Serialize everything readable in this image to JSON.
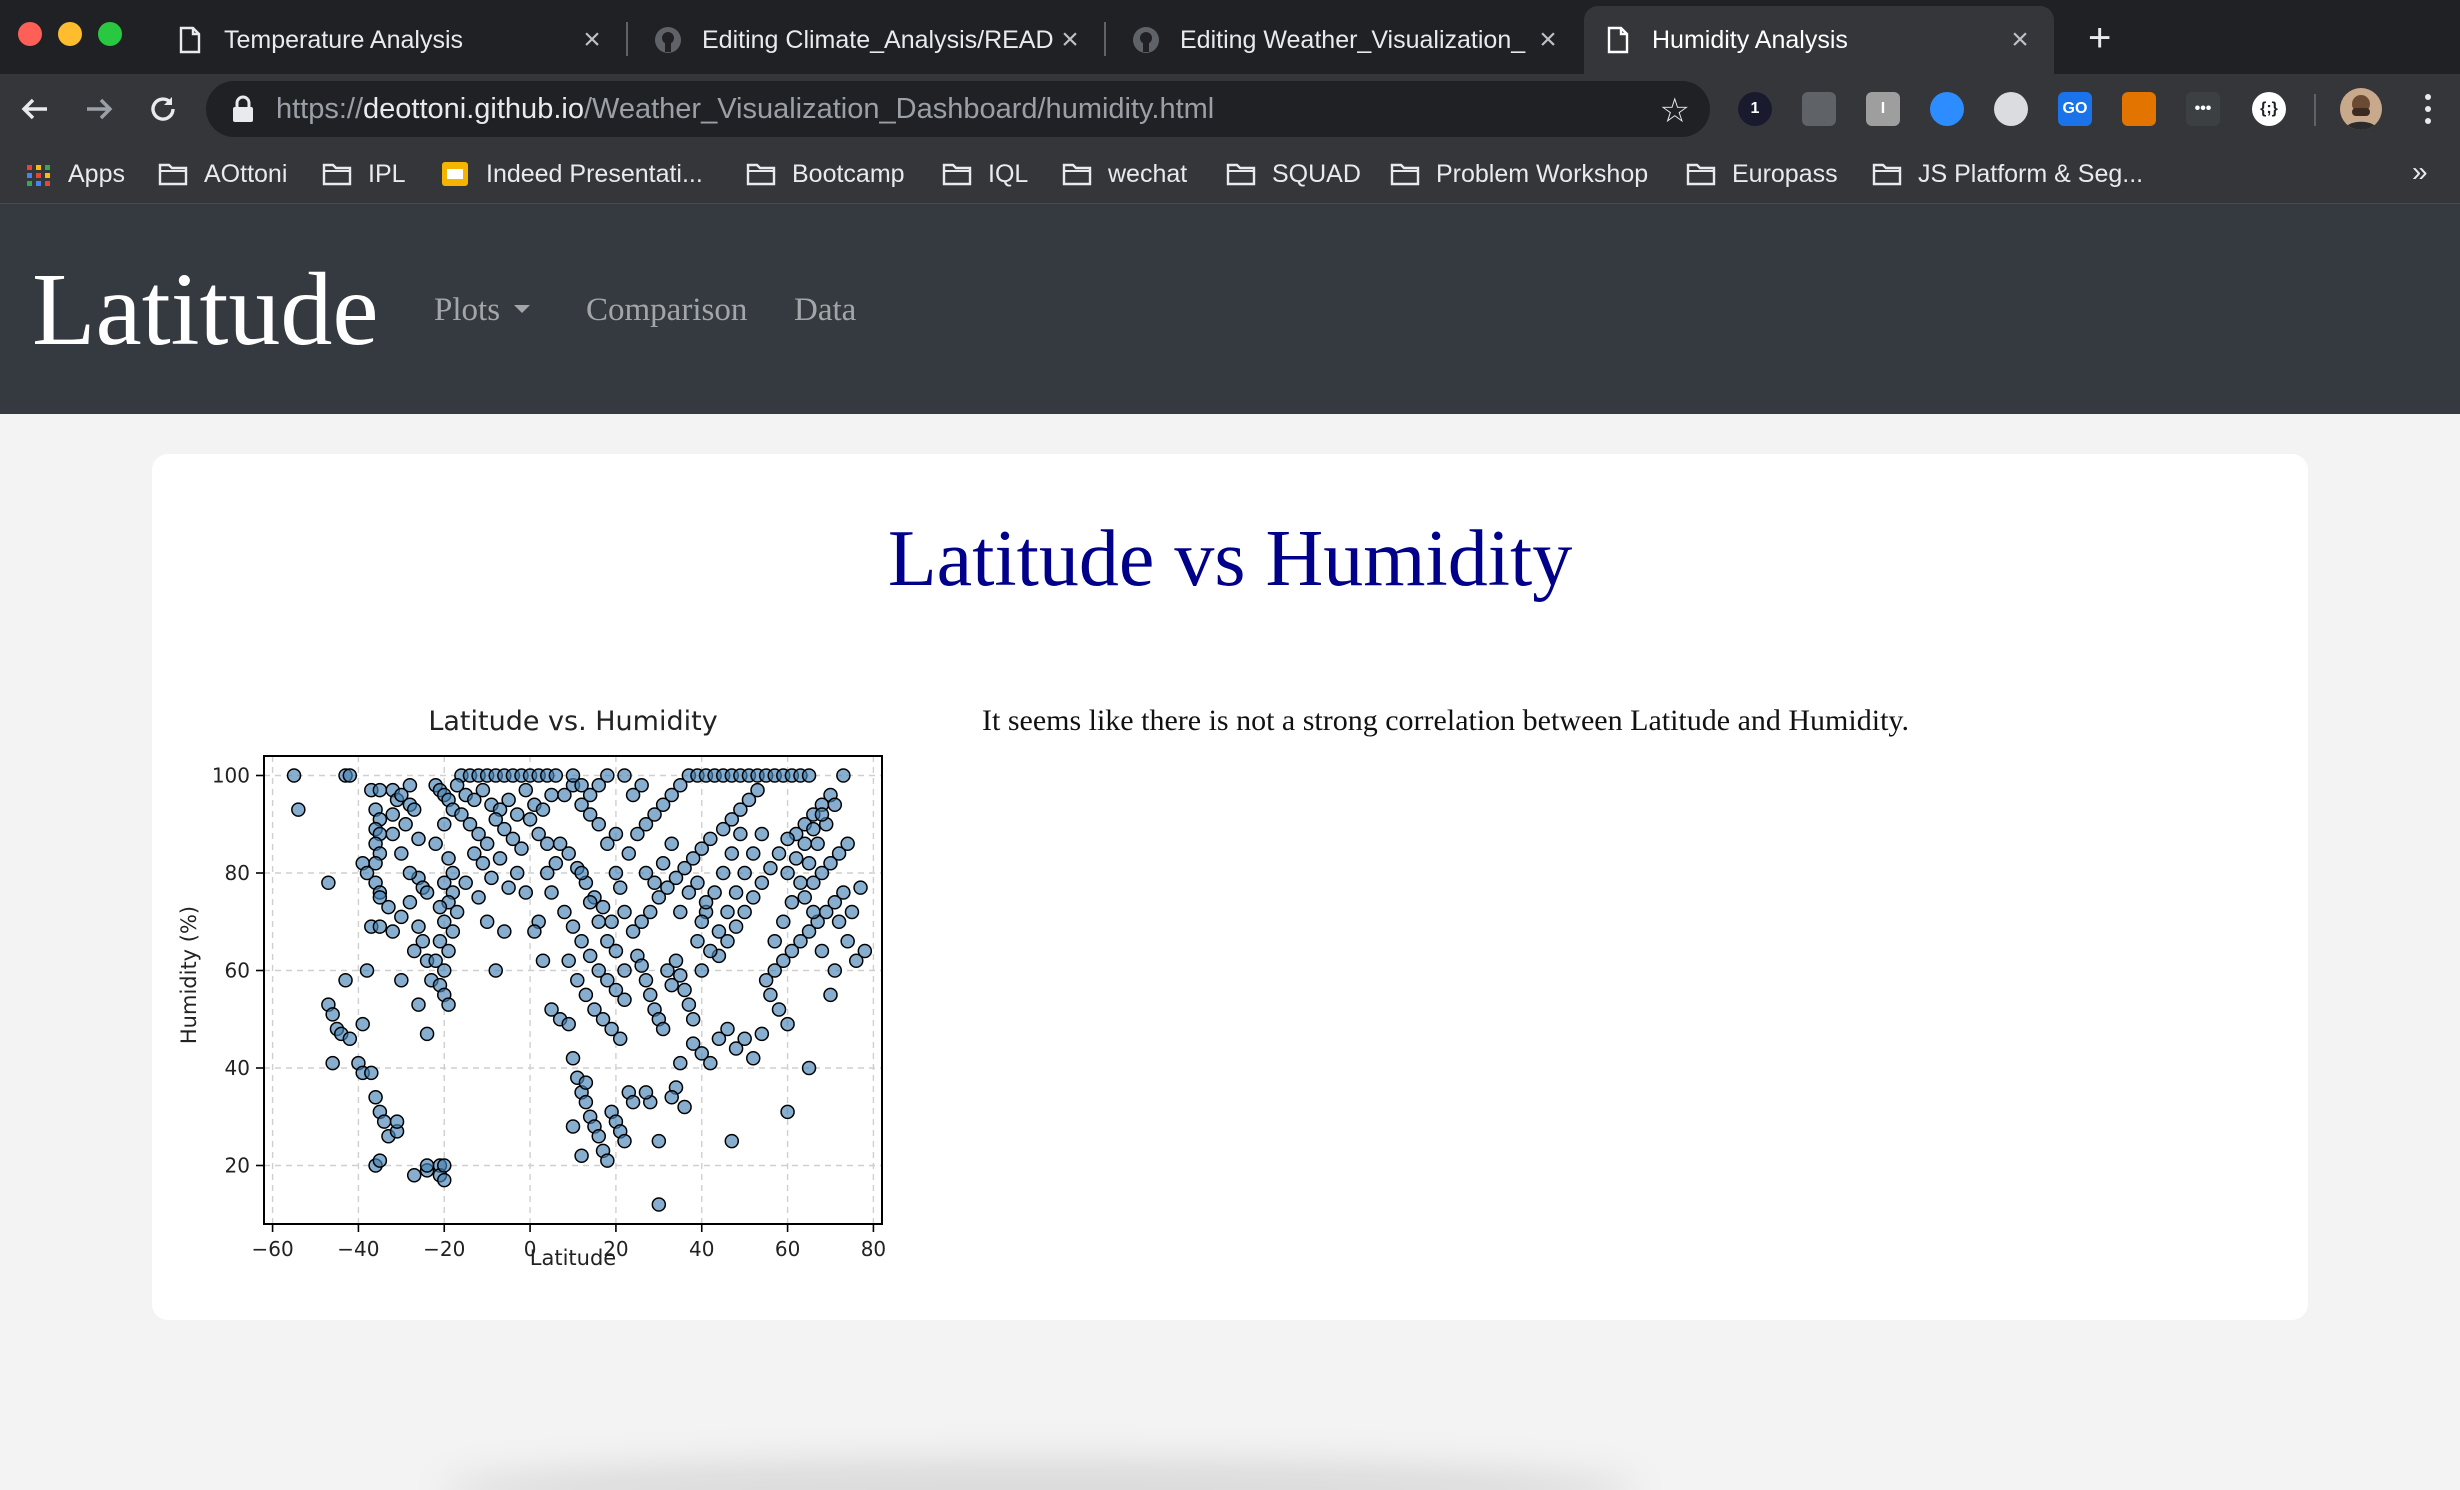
{
  "browser": {
    "tabs": [
      {
        "title": "Temperature Analysis",
        "icon": "page-icon",
        "active": false
      },
      {
        "title": "Editing Climate_Analysis/READ",
        "icon": "github-icon",
        "active": false
      },
      {
        "title": "Editing Weather_Visualization_",
        "icon": "github-icon",
        "active": false
      },
      {
        "title": "Humidity Analysis",
        "icon": "page-icon",
        "active": true
      }
    ],
    "url_scheme": "https://",
    "url_host": "deottoni.github.io",
    "url_path": "/Weather_Visualization_Dashboard/humidity.html",
    "bookmarks": [
      {
        "label": "Apps",
        "icon": "apps-grid-icon"
      },
      {
        "label": "AOttoni",
        "icon": "folder-icon"
      },
      {
        "label": "IPL",
        "icon": "folder-icon"
      },
      {
        "label": "Indeed Presentati...",
        "icon": "slides-icon"
      },
      {
        "label": "Bootcamp",
        "icon": "folder-icon"
      },
      {
        "label": "IQL",
        "icon": "folder-icon"
      },
      {
        "label": "wechat",
        "icon": "folder-icon"
      },
      {
        "label": "SQUAD",
        "icon": "folder-icon"
      },
      {
        "label": "Problem Workshop",
        "icon": "folder-icon"
      },
      {
        "label": "Europass",
        "icon": "folder-icon"
      },
      {
        "label": "JS Platform & Seg...",
        "icon": "folder-icon"
      }
    ],
    "bookmarks_overflow": "»",
    "extensions": [
      {
        "name": "onepassword-icon",
        "text": "1",
        "color": "#1a1a2e"
      },
      {
        "name": "camera-icon",
        "text": "",
        "color": "#5f6368"
      },
      {
        "name": "instapaper-icon",
        "text": "I",
        "color": "#9e9e9e"
      },
      {
        "name": "zoom-icon",
        "text": "",
        "color": "#2d8cff"
      },
      {
        "name": "circle-icon",
        "text": "",
        "color": "#dadce0"
      },
      {
        "name": "go-icon",
        "text": "GO",
        "color": "#1a73e8"
      },
      {
        "name": "stack-icon",
        "text": "",
        "color": "#e37400"
      },
      {
        "name": "more-dots-icon",
        "text": "•••",
        "color": "#3c4043"
      },
      {
        "name": "brackets-icon",
        "text": "{;}",
        "color": "#ffffff"
      }
    ]
  },
  "site": {
    "brand": "Latitude",
    "nav": [
      {
        "label": "Plots",
        "dropdown": true
      },
      {
        "label": "Comparison",
        "dropdown": false
      },
      {
        "label": "Data",
        "dropdown": false
      }
    ]
  },
  "main": {
    "heading": "Latitude vs Humidity",
    "description": "It seems like there is not a strong correlation between Latitude and Humidity."
  },
  "chart_data": {
    "type": "scatter",
    "title": "Latitude vs. Humidity",
    "xlabel": "Latitude",
    "ylabel": "Humidity (%)",
    "xlim": [
      -62,
      82
    ],
    "ylim": [
      8,
      104
    ],
    "xticks": [
      -60,
      -40,
      -20,
      0,
      20,
      40,
      60,
      80
    ],
    "yticks": [
      20,
      40,
      60,
      80,
      100
    ],
    "xtick_labels": [
      "−60",
      "−40",
      "−20",
      "0",
      "20",
      "40",
      "60",
      "80"
    ],
    "ytick_labels": [
      "20",
      "40",
      "60",
      "80",
      "100"
    ],
    "grid": true,
    "marker_face_color": "#4682b4",
    "marker_edge_color": "#000000",
    "points": [
      [
        -55,
        100
      ],
      [
        -54,
        93
      ],
      [
        -43,
        100
      ],
      [
        -42,
        100
      ],
      [
        -47,
        78
      ],
      [
        -43,
        58
      ],
      [
        -47,
        53
      ],
      [
        -46,
        51
      ],
      [
        -45,
        48
      ],
      [
        -44,
        47
      ],
      [
        -42,
        46
      ],
      [
        -46,
        41
      ],
      [
        -39,
        82
      ],
      [
        -38,
        80
      ],
      [
        -38,
        60
      ],
      [
        -39,
        49
      ],
      [
        -40,
        41
      ],
      [
        -39,
        39
      ],
      [
        -37,
        39
      ],
      [
        -36,
        34
      ],
      [
        -35,
        31
      ],
      [
        -34,
        29
      ],
      [
        -33,
        26
      ],
      [
        -31,
        27
      ],
      [
        -31,
        29
      ],
      [
        -36,
        20
      ],
      [
        -35,
        21
      ],
      [
        -37,
        97
      ],
      [
        -35,
        97
      ],
      [
        -36,
        93
      ],
      [
        -35,
        91
      ],
      [
        -36,
        89
      ],
      [
        -35,
        88
      ],
      [
        -36,
        86
      ],
      [
        -35,
        84
      ],
      [
        -36,
        82
      ],
      [
        -36,
        78
      ],
      [
        -35,
        76
      ],
      [
        -35,
        75
      ],
      [
        -37,
        69
      ],
      [
        -35,
        69
      ],
      [
        -32,
        97
      ],
      [
        -31,
        95
      ],
      [
        -32,
        92
      ],
      [
        -30,
        96
      ],
      [
        -28,
        98
      ],
      [
        -28,
        94
      ],
      [
        -27,
        93
      ],
      [
        -26,
        79
      ],
      [
        -28,
        74
      ],
      [
        -25,
        77
      ],
      [
        -24,
        76
      ],
      [
        -26,
        69
      ],
      [
        -25,
        66
      ],
      [
        -24,
        62
      ],
      [
        -23,
        58
      ],
      [
        -26,
        53
      ],
      [
        -24,
        47
      ],
      [
        -30,
        58
      ],
      [
        -32,
        68
      ],
      [
        -27,
        18
      ],
      [
        -24,
        19
      ],
      [
        -24,
        20
      ],
      [
        -21,
        20
      ],
      [
        -21,
        18
      ],
      [
        -20,
        20
      ],
      [
        -20,
        17
      ],
      [
        -22,
        98
      ],
      [
        -21,
        97
      ],
      [
        -20,
        96
      ],
      [
        -19,
        95
      ],
      [
        -18,
        93
      ],
      [
        -20,
        90
      ],
      [
        -22,
        86
      ],
      [
        -19,
        83
      ],
      [
        -18,
        80
      ],
      [
        -20,
        78
      ],
      [
        -18,
        76
      ],
      [
        -19,
        74
      ],
      [
        -21,
        73
      ],
      [
        -17,
        72
      ],
      [
        -20,
        70
      ],
      [
        -18,
        68
      ],
      [
        -21,
        66
      ],
      [
        -19,
        64
      ],
      [
        -22,
        62
      ],
      [
        -20,
        60
      ],
      [
        -21,
        57
      ],
      [
        -20,
        55
      ],
      [
        -19,
        53
      ],
      [
        -16,
        100
      ],
      [
        -14,
        100
      ],
      [
        -12,
        100
      ],
      [
        -10,
        100
      ],
      [
        -8,
        100
      ],
      [
        -6,
        100
      ],
      [
        -4,
        100
      ],
      [
        -2,
        100
      ],
      [
        0,
        100
      ],
      [
        2,
        100
      ],
      [
        4,
        100
      ],
      [
        6,
        100
      ],
      [
        -17,
        98
      ],
      [
        -15,
        96
      ],
      [
        -13,
        95
      ],
      [
        -11,
        97
      ],
      [
        -9,
        94
      ],
      [
        -7,
        93
      ],
      [
        -5,
        95
      ],
      [
        -3,
        92
      ],
      [
        -1,
        97
      ],
      [
        1,
        94
      ],
      [
        3,
        93
      ],
      [
        5,
        96
      ],
      [
        -16,
        92
      ],
      [
        -14,
        90
      ],
      [
        -12,
        88
      ],
      [
        -10,
        86
      ],
      [
        -8,
        91
      ],
      [
        -6,
        89
      ],
      [
        -4,
        87
      ],
      [
        -2,
        85
      ],
      [
        0,
        91
      ],
      [
        2,
        88
      ],
      [
        4,
        86
      ],
      [
        -13,
        84
      ],
      [
        -11,
        82
      ],
      [
        -9,
        79
      ],
      [
        -7,
        83
      ],
      [
        -5,
        77
      ],
      [
        -3,
        80
      ],
      [
        -1,
        76
      ],
      [
        -15,
        78
      ],
      [
        -12,
        75
      ],
      [
        -10,
        70
      ],
      [
        -8,
        60
      ],
      [
        -6,
        68
      ],
      [
        8,
        96
      ],
      [
        10,
        98
      ],
      [
        12,
        94
      ],
      [
        14,
        92
      ],
      [
        16,
        90
      ],
      [
        18,
        86
      ],
      [
        20,
        88
      ],
      [
        9,
        84
      ],
      [
        11,
        81
      ],
      [
        13,
        78
      ],
      [
        15,
        75
      ],
      [
        17,
        73
      ],
      [
        19,
        70
      ],
      [
        21,
        77
      ],
      [
        8,
        72
      ],
      [
        10,
        69
      ],
      [
        12,
        66
      ],
      [
        14,
        63
      ],
      [
        16,
        60
      ],
      [
        18,
        58
      ],
      [
        20,
        56
      ],
      [
        22,
        54
      ],
      [
        9,
        62
      ],
      [
        11,
        58
      ],
      [
        13,
        55
      ],
      [
        15,
        52
      ],
      [
        17,
        50
      ],
      [
        19,
        48
      ],
      [
        21,
        46
      ],
      [
        3,
        62
      ],
      [
        5,
        52
      ],
      [
        7,
        50
      ],
      [
        9,
        49
      ],
      [
        10,
        42
      ],
      [
        11,
        38
      ],
      [
        12,
        35
      ],
      [
        13,
        33
      ],
      [
        14,
        30
      ],
      [
        15,
        28
      ],
      [
        16,
        26
      ],
      [
        17,
        23
      ],
      [
        18,
        21
      ],
      [
        19,
        31
      ],
      [
        20,
        29
      ],
      [
        21,
        27
      ],
      [
        22,
        25
      ],
      [
        23,
        35
      ],
      [
        24,
        33
      ],
      [
        10,
        28
      ],
      [
        12,
        22
      ],
      [
        13,
        37
      ],
      [
        25,
        63
      ],
      [
        26,
        61
      ],
      [
        27,
        58
      ],
      [
        28,
        55
      ],
      [
        29,
        52
      ],
      [
        30,
        50
      ],
      [
        31,
        48
      ],
      [
        32,
        60
      ],
      [
        33,
        57
      ],
      [
        34,
        62
      ],
      [
        35,
        59
      ],
      [
        36,
        56
      ],
      [
        37,
        53
      ],
      [
        38,
        50
      ],
      [
        26,
        70
      ],
      [
        28,
        72
      ],
      [
        30,
        75
      ],
      [
        32,
        77
      ],
      [
        34,
        79
      ],
      [
        36,
        81
      ],
      [
        38,
        83
      ],
      [
        40,
        85
      ],
      [
        42,
        87
      ],
      [
        27,
        90
      ],
      [
        29,
        92
      ],
      [
        31,
        94
      ],
      [
        33,
        96
      ],
      [
        35,
        98
      ],
      [
        37,
        100
      ],
      [
        39,
        100
      ],
      [
        41,
        100
      ],
      [
        43,
        100
      ],
      [
        45,
        100
      ],
      [
        47,
        100
      ],
      [
        49,
        100
      ],
      [
        51,
        100
      ],
      [
        53,
        100
      ],
      [
        55,
        100
      ],
      [
        57,
        100
      ],
      [
        59,
        100
      ],
      [
        61,
        100
      ],
      [
        63,
        100
      ],
      [
        65,
        100
      ],
      [
        73,
        100
      ],
      [
        38,
        45
      ],
      [
        40,
        43
      ],
      [
        42,
        41
      ],
      [
        44,
        46
      ],
      [
        46,
        48
      ],
      [
        48,
        44
      ],
      [
        50,
        46
      ],
      [
        52,
        42
      ],
      [
        54,
        47
      ],
      [
        35,
        41
      ],
      [
        34,
        36
      ],
      [
        36,
        32
      ],
      [
        33,
        34
      ],
      [
        30,
        25
      ],
      [
        28,
        33
      ],
      [
        27,
        35
      ],
      [
        30,
        12
      ],
      [
        47,
        25
      ],
      [
        60,
        31
      ],
      [
        60,
        49
      ],
      [
        65,
        40
      ],
      [
        70,
        55
      ],
      [
        78,
        64
      ],
      [
        77,
        77
      ],
      [
        56,
        55
      ],
      [
        58,
        52
      ],
      [
        55,
        58
      ],
      [
        57,
        60
      ],
      [
        59,
        62
      ],
      [
        61,
        64
      ],
      [
        63,
        66
      ],
      [
        65,
        68
      ],
      [
        67,
        70
      ],
      [
        69,
        72
      ],
      [
        71,
        74
      ],
      [
        73,
        76
      ],
      [
        75,
        72
      ],
      [
        64,
        75
      ],
      [
        66,
        78
      ],
      [
        68,
        80
      ],
      [
        70,
        82
      ],
      [
        72,
        84
      ],
      [
        74,
        86
      ],
      [
        62,
        88
      ],
      [
        64,
        90
      ],
      [
        66,
        92
      ],
      [
        68,
        94
      ],
      [
        70,
        96
      ],
      [
        44,
        63
      ],
      [
        46,
        66
      ],
      [
        48,
        69
      ],
      [
        50,
        72
      ],
      [
        52,
        75
      ],
      [
        54,
        78
      ],
      [
        56,
        81
      ],
      [
        58,
        84
      ],
      [
        60,
        87
      ],
      [
        45,
        89
      ],
      [
        47,
        91
      ],
      [
        49,
        93
      ],
      [
        51,
        95
      ],
      [
        53,
        97
      ],
      [
        40,
        60
      ],
      [
        42,
        64
      ],
      [
        44,
        68
      ],
      [
        46,
        72
      ],
      [
        48,
        76
      ],
      [
        50,
        80
      ],
      [
        52,
        84
      ],
      [
        54,
        88
      ],
      [
        41,
        72
      ],
      [
        43,
        76
      ],
      [
        45,
        80
      ],
      [
        47,
        84
      ],
      [
        49,
        88
      ],
      [
        39,
        66
      ],
      [
        40,
        70
      ],
      [
        41,
        74
      ],
      [
        57,
        66
      ],
      [
        59,
        70
      ],
      [
        61,
        74
      ],
      [
        63,
        78
      ],
      [
        65,
        82
      ],
      [
        67,
        86
      ],
      [
        69,
        90
      ],
      [
        71,
        94
      ],
      [
        60,
        80
      ],
      [
        62,
        83
      ],
      [
        64,
        86
      ],
      [
        66,
        89
      ],
      [
        68,
        92
      ],
      [
        72,
        70
      ],
      [
        74,
        66
      ],
      [
        76,
        62
      ],
      [
        71,
        60
      ],
      [
        68,
        64
      ],
      [
        66,
        72
      ],
      [
        24,
        68
      ],
      [
        22,
        72
      ],
      [
        20,
        80
      ],
      [
        23,
        84
      ],
      [
        25,
        88
      ],
      [
        27,
        80
      ],
      [
        29,
        78
      ],
      [
        31,
        82
      ],
      [
        33,
        86
      ],
      [
        35,
        72
      ],
      [
        37,
        76
      ],
      [
        39,
        78
      ],
      [
        20,
        64
      ],
      [
        22,
        60
      ],
      [
        18,
        66
      ],
      [
        16,
        70
      ],
      [
        14,
        74
      ],
      [
        12,
        80
      ],
      [
        6,
        82
      ],
      [
        4,
        80
      ],
      [
        2,
        70
      ],
      [
        1,
        68
      ],
      [
        5,
        76
      ],
      [
        7,
        86
      ],
      [
        24,
        96
      ],
      [
        26,
        98
      ],
      [
        22,
        100
      ],
      [
        18,
        100
      ],
      [
        16,
        98
      ],
      [
        14,
        96
      ],
      [
        12,
        98
      ],
      [
        10,
        100
      ],
      [
        -28,
        80
      ],
      [
        -30,
        84
      ],
      [
        -32,
        88
      ],
      [
        -29,
        90
      ],
      [
        -26,
        87
      ],
      [
        -33,
        73
      ],
      [
        -30,
        71
      ],
      [
        -27,
        64
      ]
    ]
  }
}
